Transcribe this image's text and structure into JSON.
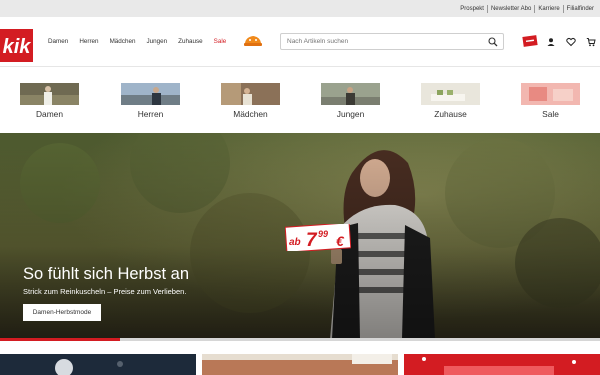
{
  "utility_bar": {
    "links": [
      "Prospekt",
      "Newsletter Abo",
      "Karriere",
      "Filialfinder"
    ]
  },
  "header": {
    "logo_text": "kik",
    "brand_color": "#d31c22",
    "nav": [
      {
        "label": "Damen",
        "icon": ""
      },
      {
        "label": "Herren"
      },
      {
        "label": "Mädchen"
      },
      {
        "label": "Jungen"
      },
      {
        "label": "Zuhause"
      },
      {
        "label": "Sale",
        "color": "#d31c22"
      }
    ],
    "deal_icon": "deal-badge-icon",
    "search": {
      "placeholder": "Nach Artikeln suchen",
      "value": ""
    },
    "icons": [
      "my-kik-icon",
      "account-icon",
      "wishlist-heart-icon",
      "cart-icon"
    ]
  },
  "categories": [
    {
      "label": "Damen"
    },
    {
      "label": "Herren"
    },
    {
      "label": "Mädchen"
    },
    {
      "label": "Jungen"
    },
    {
      "label": "Zuhause"
    },
    {
      "label": "Sale"
    }
  ],
  "hero": {
    "price_prefix": "ab",
    "price_main": "7",
    "price_cents": "99",
    "price_currency": "€",
    "title": "So fühlt sich Herbst an",
    "subtitle": "Strick zum Reinkuscheln – Preise zum Verlieben.",
    "cta": "Damen-Herbstmode"
  },
  "slider": {
    "progress": 0.2,
    "accent": "#d31c22"
  }
}
